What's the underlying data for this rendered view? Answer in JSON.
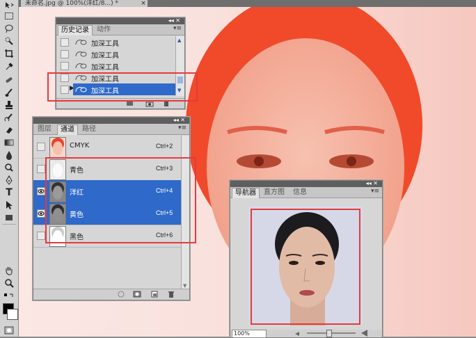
{
  "document": {
    "tab_title": "未命名.jpg @ 100%(洋红/8...) *",
    "close": "×"
  },
  "toolbar": {
    "tools": [
      "move-icon",
      "marquee-icon",
      "lasso-icon",
      "quick-select-icon",
      "crop-icon",
      "eyedropper-icon",
      "healing-brush-icon",
      "brush-icon",
      "clone-stamp-icon",
      "history-brush-icon",
      "eraser-icon",
      "gradient-icon",
      "blur-icon",
      "dodge-icon",
      "pen-icon",
      "type-icon",
      "path-select-icon",
      "shape-icon",
      "hand-icon",
      "zoom-icon"
    ],
    "type_glyph": "T"
  },
  "history_panel": {
    "tabs": [
      "历史记录",
      "动作"
    ],
    "panel_controls": "◂◂ ✕",
    "menu": "▾≡",
    "items": [
      "加深工具",
      "加深工具",
      "加深工具",
      "加深工具",
      "加深工具"
    ],
    "selected_index": 4
  },
  "channels_panel": {
    "tabs": [
      "图层",
      "通道",
      "路径"
    ],
    "panel_controls": "◂◂ ✕",
    "menu": "▾≡",
    "channels": [
      {
        "name": "CMYK",
        "shortcut": "Ctrl+2",
        "visible": false,
        "selected": false
      },
      {
        "name": "青色",
        "shortcut": "Ctrl+3",
        "visible": false,
        "selected": false
      },
      {
        "name": "洋红",
        "shortcut": "Ctrl+4",
        "visible": true,
        "selected": true
      },
      {
        "name": "黄色",
        "shortcut": "Ctrl+5",
        "visible": true,
        "selected": true
      },
      {
        "name": "黑色",
        "shortcut": "Ctrl+6",
        "visible": false,
        "selected": false
      }
    ]
  },
  "navigator_panel": {
    "tabs": [
      "导航器",
      "直方图",
      "信息"
    ],
    "panel_controls": "◂◂ ✕",
    "menu": "▾≡",
    "zoom": "100%"
  },
  "colors": {
    "selection": "#2f69c9",
    "highlight_box": "#e8383d",
    "canvas_tint": "#f04a2a"
  }
}
